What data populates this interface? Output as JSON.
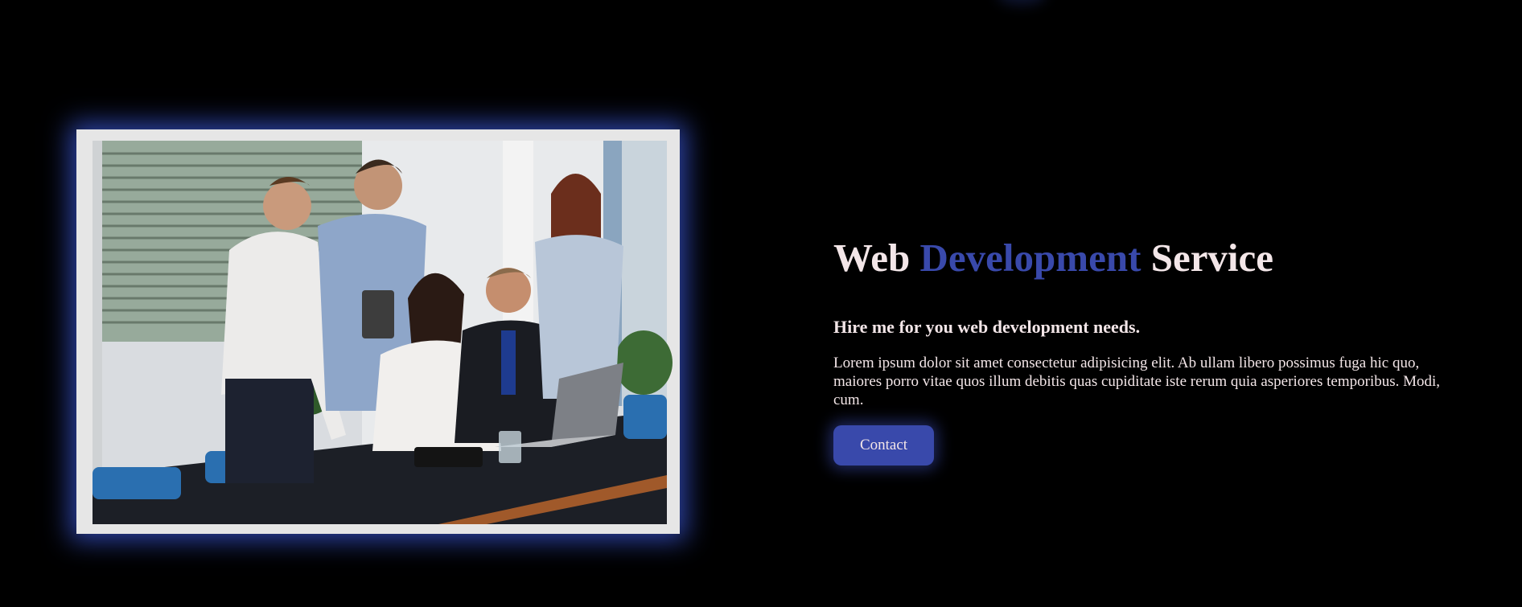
{
  "hero": {
    "image_alt": "Team of colleagues gathered around a laptop at a conference table",
    "headline": {
      "part1": "Web ",
      "accent": "Development",
      "part2": " Service"
    },
    "subheading": "Hire me for you web development needs.",
    "body": "Lorem ipsum dolor sit amet consectetur adipisicing elit. Ab ullam libero possimus fuga hic quo, maiores porro vitae quos illum debitis quas cupiditate iste rerum quia asperiores temporibus. Modi, cum.",
    "cta_label": "Contact"
  },
  "colors": {
    "background": "#000000",
    "accent": "#3949ab",
    "text": "#f3e6e8",
    "glow": "#3c5adc"
  }
}
